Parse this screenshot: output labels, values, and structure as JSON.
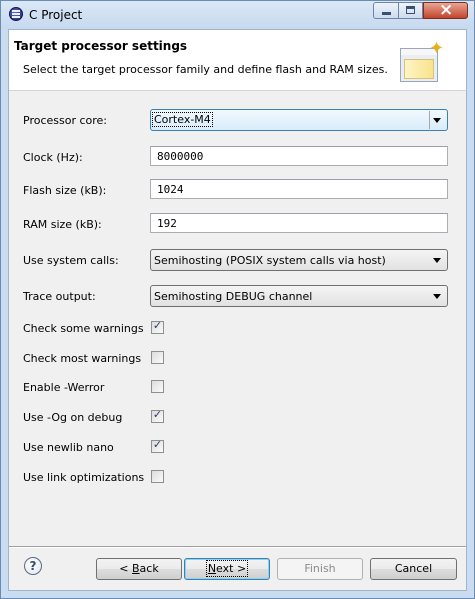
{
  "window": {
    "title": "C Project"
  },
  "header": {
    "title": "Target processor settings",
    "description": "Select the target processor family and define flash and RAM sizes."
  },
  "form": {
    "processor_core": {
      "label": "Processor core:",
      "value": "Cortex-M4"
    },
    "clock": {
      "label": "Clock (Hz):",
      "value": "8000000"
    },
    "flash_size": {
      "label": "Flash size (kB):",
      "value": "1024"
    },
    "ram_size": {
      "label": "RAM size (kB):",
      "value": "192"
    },
    "system_calls": {
      "label": "Use system calls:",
      "value": "Semihosting (POSIX system calls via host)"
    },
    "trace_output": {
      "label": "Trace output:",
      "value": "Semihosting DEBUG channel"
    },
    "checkboxes": [
      {
        "label": "Check some warnings",
        "checked": true
      },
      {
        "label": "Check most warnings",
        "checked": false
      },
      {
        "label": "Enable -Werror",
        "checked": false
      },
      {
        "label": "Use -Og on debug",
        "checked": true
      },
      {
        "label": "Use newlib nano",
        "checked": true
      },
      {
        "label": "Use link optimizations",
        "checked": false
      }
    ]
  },
  "buttons": {
    "help": "?",
    "back_prefix": "< ",
    "back_access": "B",
    "back_rest": "ack",
    "next_access": "N",
    "next_rest": "ext >",
    "finish": "Finish",
    "cancel": "Cancel"
  },
  "icons": {
    "app": "eclipse-icon",
    "wizard_banner": "new-project-wizard-icon",
    "help": "help-icon"
  }
}
